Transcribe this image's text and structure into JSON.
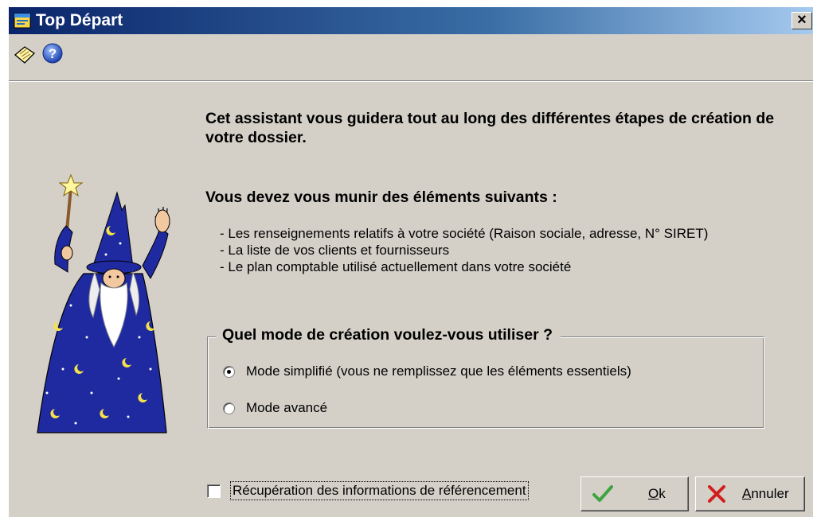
{
  "window": {
    "title": "Top Départ",
    "close_glyph": "×"
  },
  "toolbar": {
    "icons": [
      "notepad-icon",
      "help-icon"
    ]
  },
  "content": {
    "intro": "Cet assistant vous guidera tout au long des différentes étapes de création de votre dossier.",
    "need_title": "Vous devez vous munir des éléments suivants :",
    "items": [
      "- Les renseignements relatifs à votre société (Raison sociale, adresse, N° SIRET)",
      "- La liste de vos clients et fournisseurs",
      "- Le plan comptable utilisé actuellement dans votre société"
    ]
  },
  "mode_group": {
    "title": "Quel mode de création voulez-vous utiliser ?",
    "options": [
      {
        "label": "Mode simplifié (vous ne remplissez que les éléments essentiels)",
        "selected": true
      },
      {
        "label": "Mode avancé",
        "selected": false
      }
    ]
  },
  "footer": {
    "checkbox_label": "Récupération des informations de référencement",
    "checkbox_checked": false,
    "ok_accel": "O",
    "ok_rest": "k",
    "cancel_accel": "A",
    "cancel_rest": "nnuler"
  },
  "colors": {
    "title_gradient_start": "#0a246a",
    "title_gradient_end": "#a6caf0",
    "face": "#d4d0c8",
    "ok_check": "#3fa33f",
    "cancel_x": "#d21e1e"
  }
}
